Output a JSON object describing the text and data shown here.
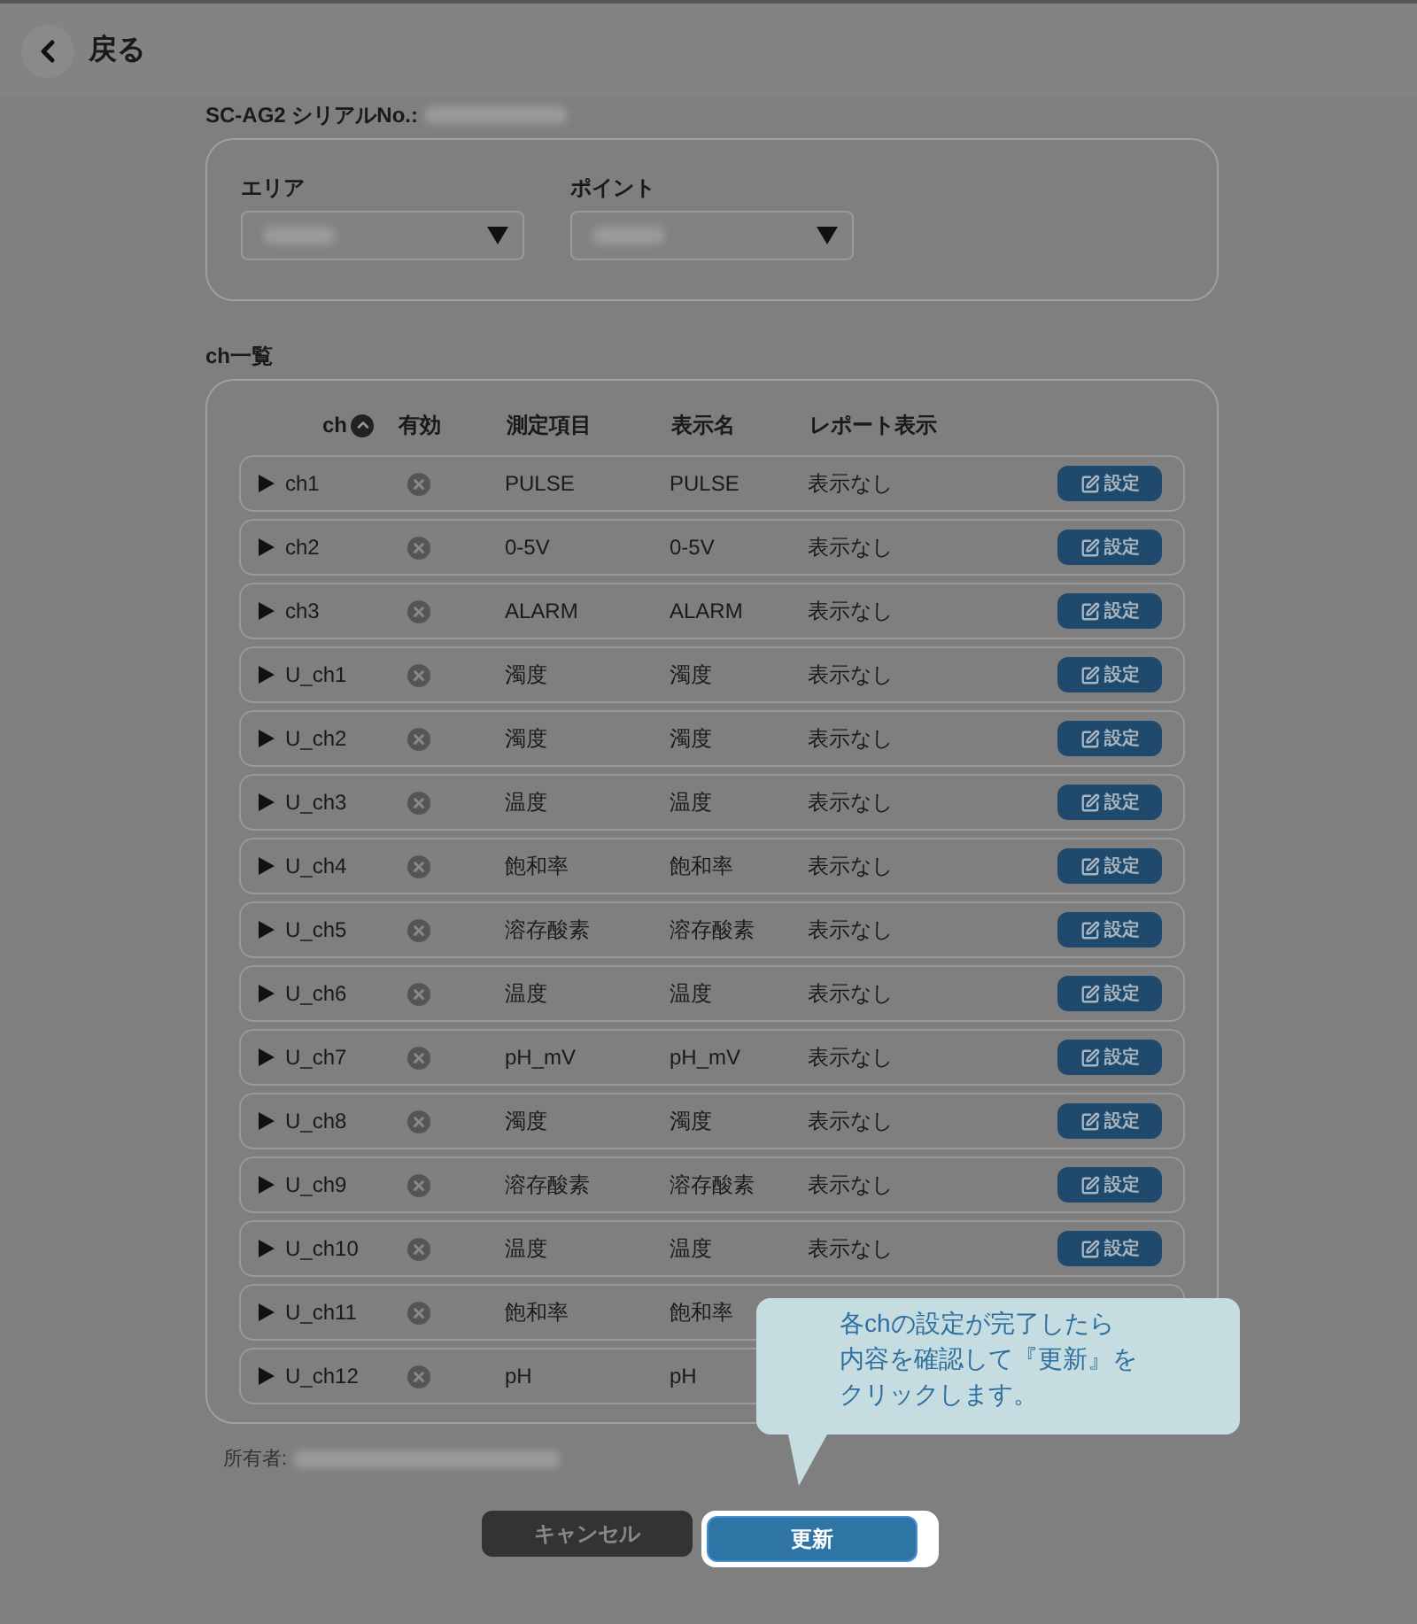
{
  "header": {
    "back_label": "戻る"
  },
  "device": {
    "serial_label": "SC-AG2 シリアルNo.:",
    "area_label": "エリア",
    "point_label": "ポイント"
  },
  "channel_list": {
    "title": "ch一覧",
    "columns": [
      "ch",
      "有効",
      "測定項目",
      "表示名",
      "レポート表示"
    ],
    "rows": [
      {
        "ch": "ch1",
        "enabled": false,
        "measure": "PULSE",
        "display": "PULSE",
        "report": "表示なし",
        "button": "設定"
      },
      {
        "ch": "ch2",
        "enabled": false,
        "measure": "0-5V",
        "display": "0-5V",
        "report": "表示なし",
        "button": "設定"
      },
      {
        "ch": "ch3",
        "enabled": false,
        "measure": "ALARM",
        "display": "ALARM",
        "report": "表示なし",
        "button": "設定"
      },
      {
        "ch": "U_ch1",
        "enabled": false,
        "measure": "濁度",
        "display": "濁度",
        "report": "表示なし",
        "button": "設定"
      },
      {
        "ch": "U_ch2",
        "enabled": false,
        "measure": "濁度",
        "display": "濁度",
        "report": "表示なし",
        "button": "設定"
      },
      {
        "ch": "U_ch3",
        "enabled": false,
        "measure": "温度",
        "display": "温度",
        "report": "表示なし",
        "button": "設定"
      },
      {
        "ch": "U_ch4",
        "enabled": false,
        "measure": "飽和率",
        "display": "飽和率",
        "report": "表示なし",
        "button": "設定"
      },
      {
        "ch": "U_ch5",
        "enabled": false,
        "measure": "溶存酸素",
        "display": "溶存酸素",
        "report": "表示なし",
        "button": "設定"
      },
      {
        "ch": "U_ch6",
        "enabled": false,
        "measure": "温度",
        "display": "温度",
        "report": "表示なし",
        "button": "設定"
      },
      {
        "ch": "U_ch7",
        "enabled": false,
        "measure": "pH_mV",
        "display": "pH_mV",
        "report": "表示なし",
        "button": "設定"
      },
      {
        "ch": "U_ch8",
        "enabled": false,
        "measure": "濁度",
        "display": "濁度",
        "report": "表示なし",
        "button": "設定"
      },
      {
        "ch": "U_ch9",
        "enabled": false,
        "measure": "溶存酸素",
        "display": "溶存酸素",
        "report": "表示なし",
        "button": "設定"
      },
      {
        "ch": "U_ch10",
        "enabled": false,
        "measure": "温度",
        "display": "温度",
        "report": "表示なし",
        "button": "設定"
      },
      {
        "ch": "U_ch11",
        "enabled": false,
        "measure": "飽和率",
        "display": "飽和率"
      },
      {
        "ch": "U_ch12",
        "enabled": false,
        "measure": "pH",
        "display": "pH"
      }
    ]
  },
  "owner_label": "所有者:",
  "buttons": {
    "cancel": "キャンセル",
    "update": "更新"
  },
  "callout": {
    "lines": [
      "各chの設定が完了したら",
      "内容を確認して『更新』を",
      "クリックします。"
    ]
  }
}
